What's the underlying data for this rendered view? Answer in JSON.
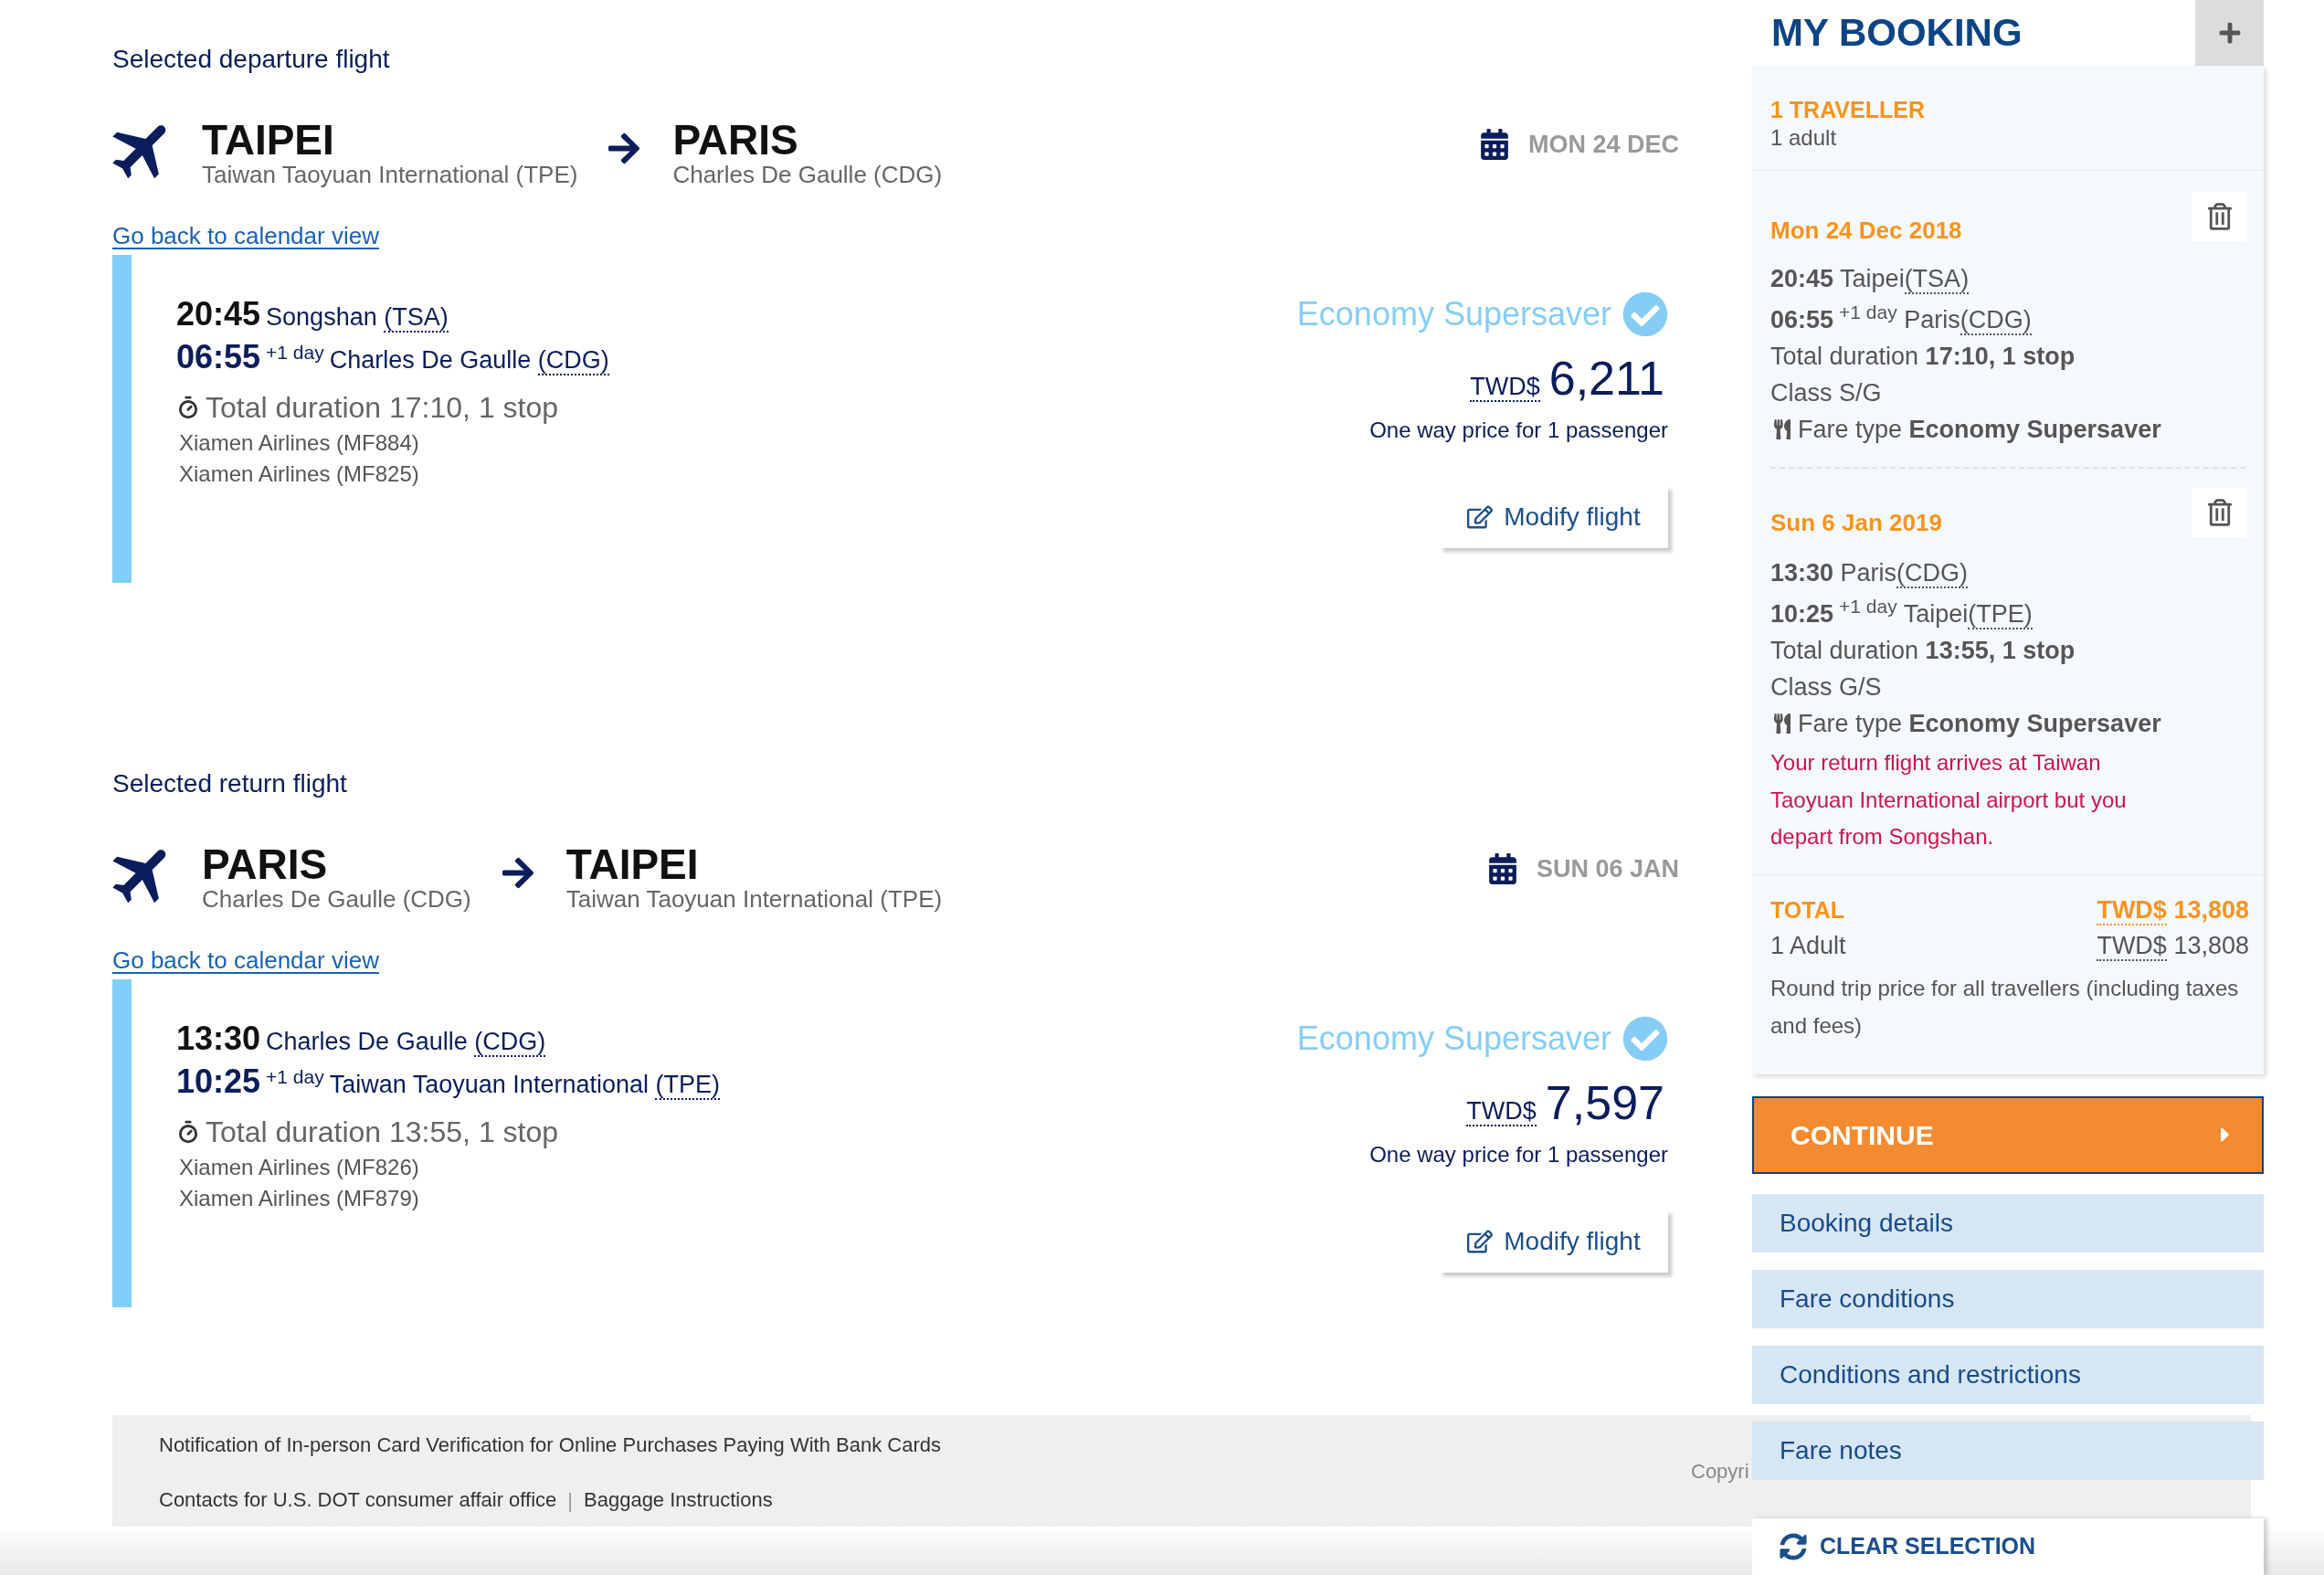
{
  "flights": [
    {
      "heading": "Selected departure flight",
      "origin": {
        "city": "TAIPEI",
        "airport": "Taiwan Taoyuan International (TPE)"
      },
      "destination": {
        "city": "PARIS",
        "airport": "Charles De Gaulle (CDG)"
      },
      "date": "MON 24 DEC",
      "calendar_link": "Go back to calendar view",
      "departure": {
        "time": "20:45",
        "airport": "Songshan",
        "code": "(TSA)"
      },
      "arrival": {
        "time": "06:55",
        "day_offset": "+1 day",
        "airport": "Charles De Gaulle",
        "code": "(CDG)"
      },
      "duration": "Total duration 17:10, 1 stop",
      "legs": [
        "Xiamen Airlines (MF884)",
        "Xiamen Airlines (MF825)"
      ],
      "fare": {
        "name": "Economy Supersaver",
        "selected": true,
        "currency": "TWD$",
        "amount": "6,211",
        "note": "One way price for 1 passenger"
      },
      "modify_button": "Modify flight"
    },
    {
      "heading": "Selected return flight",
      "origin": {
        "city": "PARIS",
        "airport": "Charles De Gaulle (CDG)"
      },
      "destination": {
        "city": "TAIPEI",
        "airport": "Taiwan Taoyuan International (TPE)"
      },
      "date": "SUN 06 JAN",
      "calendar_link": "Go back to calendar view",
      "departure": {
        "time": "13:30",
        "airport": "Charles De Gaulle",
        "code": "(CDG)"
      },
      "arrival": {
        "time": "10:25",
        "day_offset": "+1 day",
        "airport": "Taiwan Taoyuan International",
        "code": "(TPE)"
      },
      "duration": "Total duration 13:55, 1 stop",
      "legs": [
        "Xiamen Airlines (MF826)",
        "Xiamen Airlines (MF879)"
      ],
      "fare": {
        "name": "Economy Supersaver",
        "selected": true,
        "currency": "TWD$",
        "amount": "7,597",
        "note": "One way price for 1 passenger"
      },
      "modify_button": "Modify flight"
    }
  ],
  "booking": {
    "title": "MY BOOKING",
    "travellers": {
      "count": "1 TRAVELLER",
      "detail": "1 adult"
    },
    "segments": [
      {
        "date": "Mon 24 Dec 2018",
        "departure": {
          "time": "20:45",
          "city": "Taipei",
          "code": "(TSA)"
        },
        "arrival": {
          "time": "06:55",
          "day_offset": "+1 day",
          "city": "Paris",
          "code": "(CDG)"
        },
        "duration": "Total duration **17:10, 1 stop**",
        "fare_class": "Class S/G",
        "fare_type": "Fare type **Economy Supersaver**"
      },
      {
        "date": "Sun 6 Jan 2019",
        "departure": {
          "time": "13:30",
          "city": "Paris",
          "code": "(CDG)"
        },
        "arrival": {
          "time": "10:25",
          "day_offset": "+1 day",
          "city": "Taipei",
          "code": "(TPE)"
        },
        "duration": "Total duration **13:55, 1 stop**",
        "fare_class": "Class G/S",
        "fare_type": "Fare type **Economy Supersaver**",
        "warning": "Your return flight arrives at Taiwan Taoyuan International airport but you depart from Songshan."
      }
    ],
    "total": {
      "label": "TOTAL",
      "currency": "TWD$",
      "amount": "13,808",
      "rows": [
        {
          "label": "1 Adult",
          "currency": "TWD$",
          "amount": "13,808"
        }
      ],
      "note": "Round trip price for all travellers (including taxes and fees)"
    },
    "continue_button": "CONTINUE",
    "menu": [
      "Booking details",
      "Fare conditions",
      "Conditions and restrictions",
      "Fare notes"
    ],
    "clear_button": "CLEAR SELECTION"
  },
  "footer": {
    "rows": [
      {
        "links": [
          "Notification of In-person Card Verification for Online Purchases Paying With Bank Cards"
        ]
      },
      {
        "links": [
          "Contacts for U.S. DOT consumer affair office",
          "Baggage Instructions"
        ]
      }
    ],
    "separator": "|",
    "copyright": "Copyri"
  }
}
